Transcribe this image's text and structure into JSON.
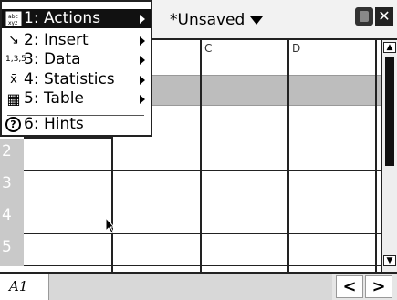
{
  "title_bar": {
    "document_title": "*Unsaved"
  },
  "menu": {
    "items": [
      {
        "label": "1: Actions",
        "icon": "actions-icon",
        "has_submenu": true,
        "active": true
      },
      {
        "label": "2: Insert",
        "icon": "insert-icon",
        "has_submenu": true,
        "active": false
      },
      {
        "label": "3: Data",
        "icon": "data-icon",
        "has_submenu": true,
        "active": false
      },
      {
        "label": "4: Statistics",
        "icon": "statistics-icon",
        "has_submenu": true,
        "active": false
      },
      {
        "label": "5: Table",
        "icon": "table-icon",
        "has_submenu": true,
        "active": false
      },
      {
        "label": "6: Hints",
        "icon": "hints-icon",
        "has_submenu": false,
        "active": false
      }
    ],
    "icon_glyphs": {
      "insert": "↘",
      "data": "1,3,5",
      "statistics": "x̄",
      "table": "▦",
      "hints": "?"
    }
  },
  "sheet": {
    "column_headers": [
      "C",
      "D"
    ],
    "row_numbers": [
      "2",
      "3",
      "4",
      "5"
    ]
  },
  "status_bar": {
    "cell_reference": "A1",
    "nav_prev": "<",
    "nav_next": ">"
  },
  "colors": {
    "accent": "#111111",
    "row_number_bg": "#c9c9c9",
    "header_row_bg": "#bdbdbd"
  }
}
